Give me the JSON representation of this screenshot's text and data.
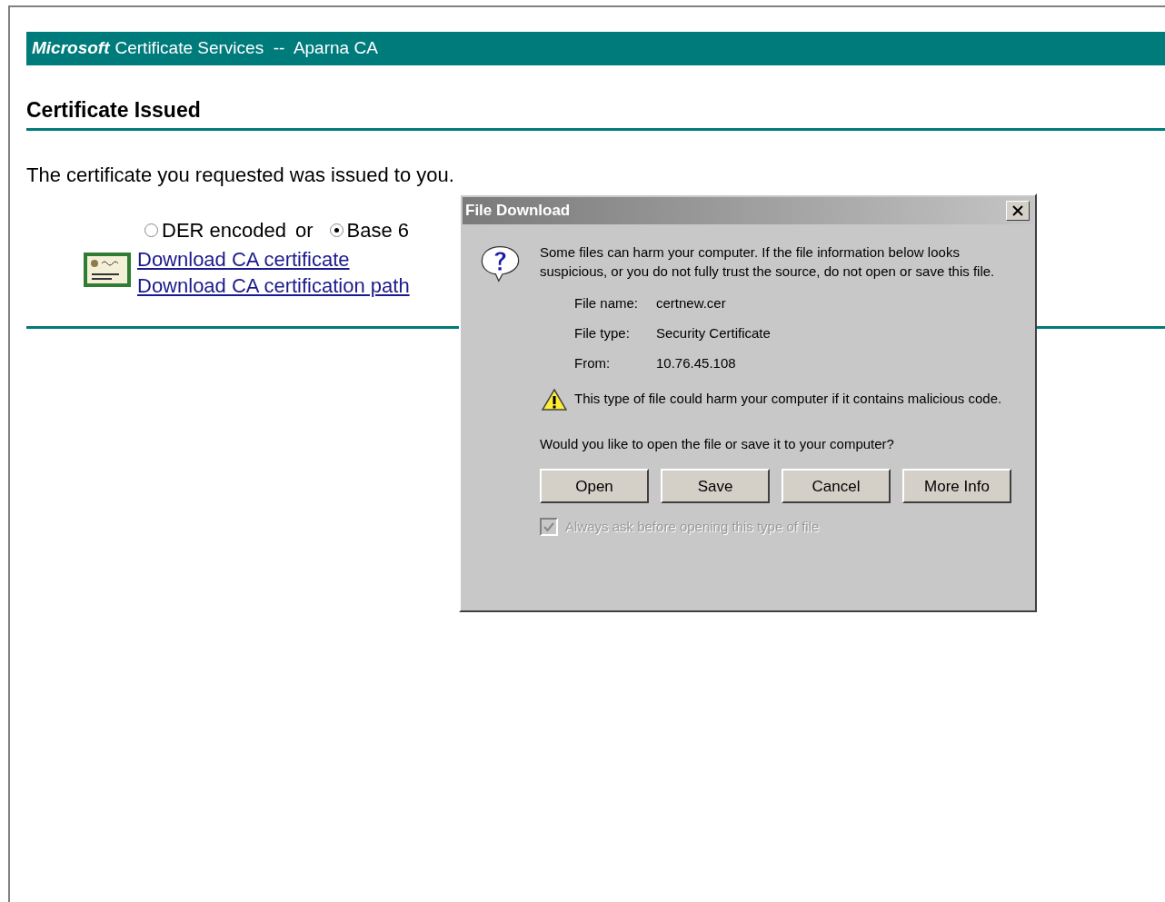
{
  "banner": {
    "brand": "Microsoft",
    "title": "Certificate Services  --  Aparna CA"
  },
  "heading": "Certificate Issued",
  "message": "The certificate you requested was issued to you.",
  "encoding": {
    "options": [
      {
        "label": "DER encoded",
        "selected": false
      },
      {
        "label": "Base 6",
        "selected": true
      }
    ],
    "separator": "or"
  },
  "links": [
    "Download CA certificate",
    "Download CA certification path"
  ],
  "dialog": {
    "title": "File Download",
    "warning": "Some files can harm your computer. If the file information below looks suspicious, or you do not fully trust the source, do not open or save this file.",
    "fields": [
      {
        "label": "File name:",
        "value": "certnew.cer"
      },
      {
        "label": "File type:",
        "value": "Security Certificate"
      },
      {
        "label": "From:",
        "value": "10.76.45.108"
      }
    ],
    "caution": "This type of file could harm your computer if it contains malicious code.",
    "question": "Would you like to open the file or save it to your computer?",
    "buttons": [
      "Open",
      "Save",
      "Cancel",
      "More Info"
    ],
    "always_ask": {
      "label": "Always ask before opening this type of file",
      "checked": true,
      "disabled": true
    }
  }
}
